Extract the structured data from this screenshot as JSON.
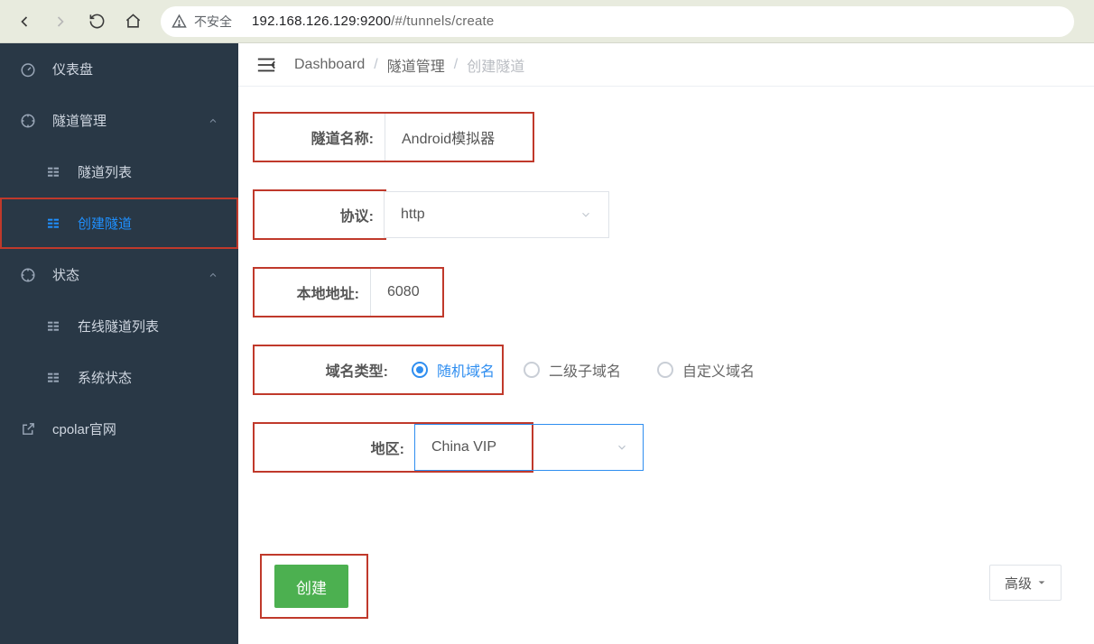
{
  "browser": {
    "insecure_label": "不安全",
    "url_host": "192.168.126.129:9200",
    "url_path": "/#/tunnels/create"
  },
  "sidebar": {
    "dashboard": "仪表盘",
    "tunnel_mgmt": "隧道管理",
    "tunnel_list": "隧道列表",
    "create_tunnel": "创建隧道",
    "status": "状态",
    "online_tunnels": "在线隧道列表",
    "system_status": "系统状态",
    "cpolar_site": "cpolar官网"
  },
  "breadcrumb": {
    "root": "Dashboard",
    "mid": "隧道管理",
    "current": "创建隧道"
  },
  "form": {
    "name_label": "隧道名称:",
    "name_value": "Android模拟器",
    "proto_label": "协议:",
    "proto_value": "http",
    "addr_label": "本地地址:",
    "addr_value": "6080",
    "dtype_label": "域名类型:",
    "dtype_random": "随机域名",
    "dtype_sub": "二级子域名",
    "dtype_custom": "自定义域名",
    "region_label": "地区:",
    "region_value": "China VIP",
    "advanced": "高级",
    "create": "创建"
  }
}
